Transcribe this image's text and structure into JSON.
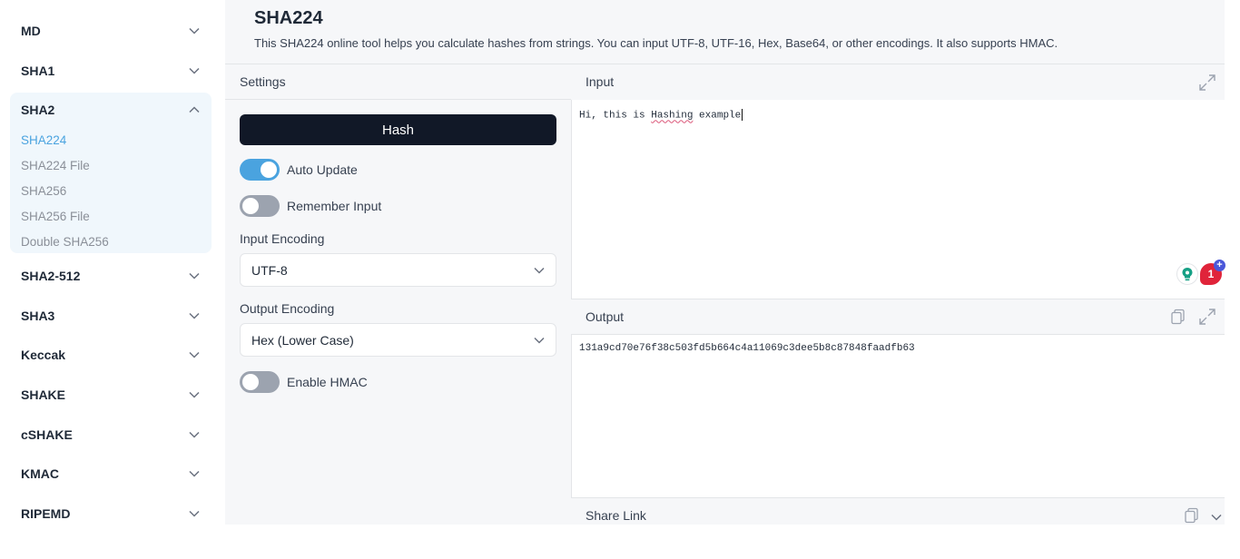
{
  "sidebar": {
    "groups": [
      {
        "label": "MD"
      },
      {
        "label": "SHA1"
      },
      {
        "label": "SHA2",
        "items": [
          "SHA224",
          "SHA224 File",
          "SHA256",
          "SHA256 File",
          "Double SHA256"
        ]
      },
      {
        "label": "SHA2-512"
      },
      {
        "label": "SHA3"
      },
      {
        "label": "Keccak"
      },
      {
        "label": "SHAKE"
      },
      {
        "label": "cSHAKE"
      },
      {
        "label": "KMAC"
      },
      {
        "label": "RIPEMD"
      }
    ],
    "active_item": "SHA224"
  },
  "header": {
    "title": "SHA224",
    "description": "This SHA224 online tool helps you calculate hashes from strings. You can input UTF-8, UTF-16, Hex, Base64, or other encodings. It also supports HMAC."
  },
  "settings": {
    "label": "Settings",
    "hash_button": "Hash",
    "auto_update": {
      "label": "Auto Update",
      "on": true
    },
    "remember_input": {
      "label": "Remember Input",
      "on": false
    },
    "input_encoding": {
      "label": "Input Encoding",
      "value": "UTF-8"
    },
    "output_encoding": {
      "label": "Output Encoding",
      "value": "Hex (Lower Case)"
    },
    "enable_hmac": {
      "label": "Enable HMAC",
      "on": false
    }
  },
  "input": {
    "label": "Input",
    "text_before": "Hi, this is ",
    "text_misspelled": "Hashing",
    "text_after": " example"
  },
  "output": {
    "label": "Output",
    "value": "131a9cd70e76f38c503fd5b664c4a11069c3dee5b8c87848faadfb63"
  },
  "share": {
    "label": "Share Link"
  },
  "badges": {
    "notification_count": "1",
    "plus": "+"
  },
  "colors": {
    "accent": "#4aa3df",
    "button_dark": "#111827",
    "sidebar_active_bg": "#f0f7fc",
    "badge_red": "#e0243a"
  }
}
